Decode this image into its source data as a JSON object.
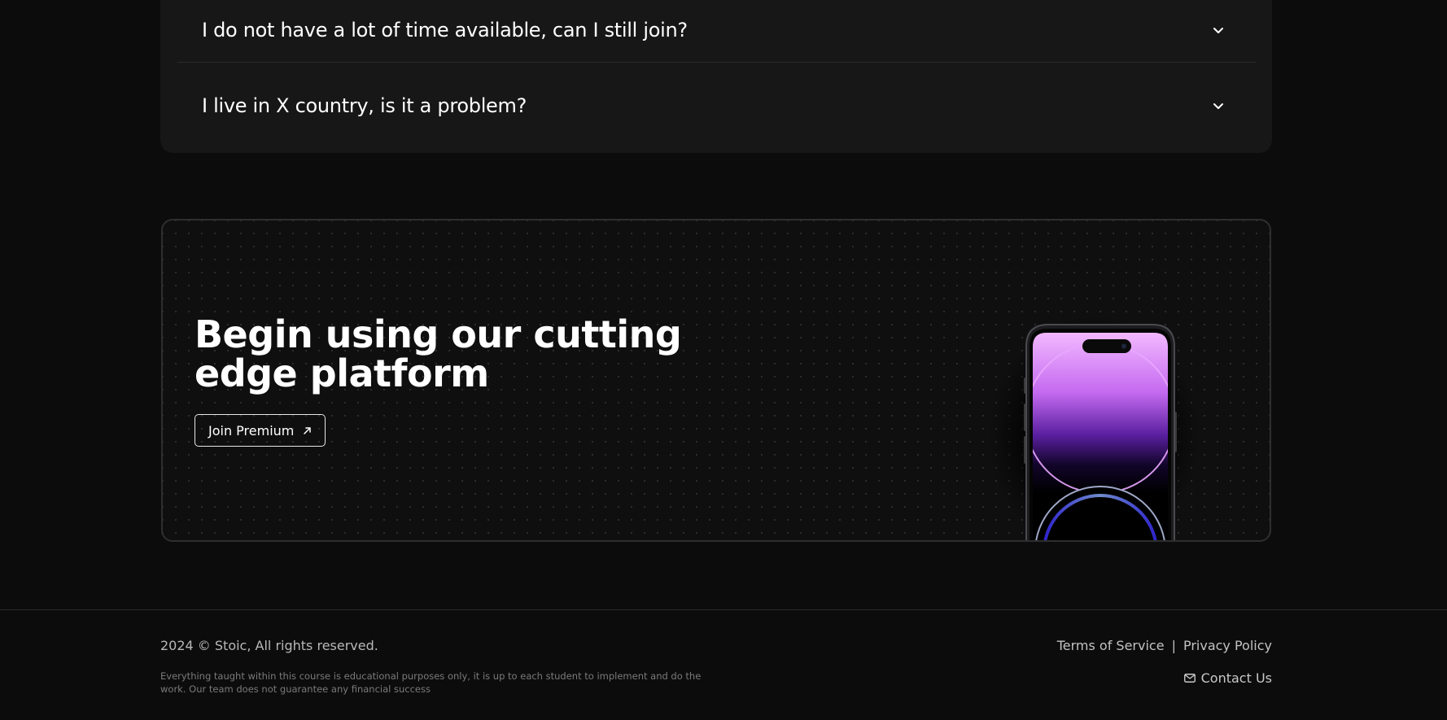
{
  "faq": {
    "items": [
      {
        "question": "I do not have a lot of time available, can I still join?"
      },
      {
        "question": "I live in X country, is it a problem?"
      }
    ]
  },
  "cta": {
    "heading": "Begin using our cutting edge platform",
    "button_label": "Join Premium",
    "button_icon": "arrow-up-right-icon",
    "image": "phone-mockup"
  },
  "footer": {
    "copyright": "2024 © Stoic, All rights reserved.",
    "disclaimer": "Everything taught within this course is educational purposes only, it is up to each student to implement and do the work. Our team does not guarantee any financial success",
    "terms": "Terms of Service",
    "separator": "|",
    "privacy": "Privacy Policy",
    "contact": "Contact Us",
    "contact_icon": "mail-icon"
  },
  "colors": {
    "background": "#0c0c0c",
    "card": "#171717",
    "accent_purple": "#b56bff"
  }
}
